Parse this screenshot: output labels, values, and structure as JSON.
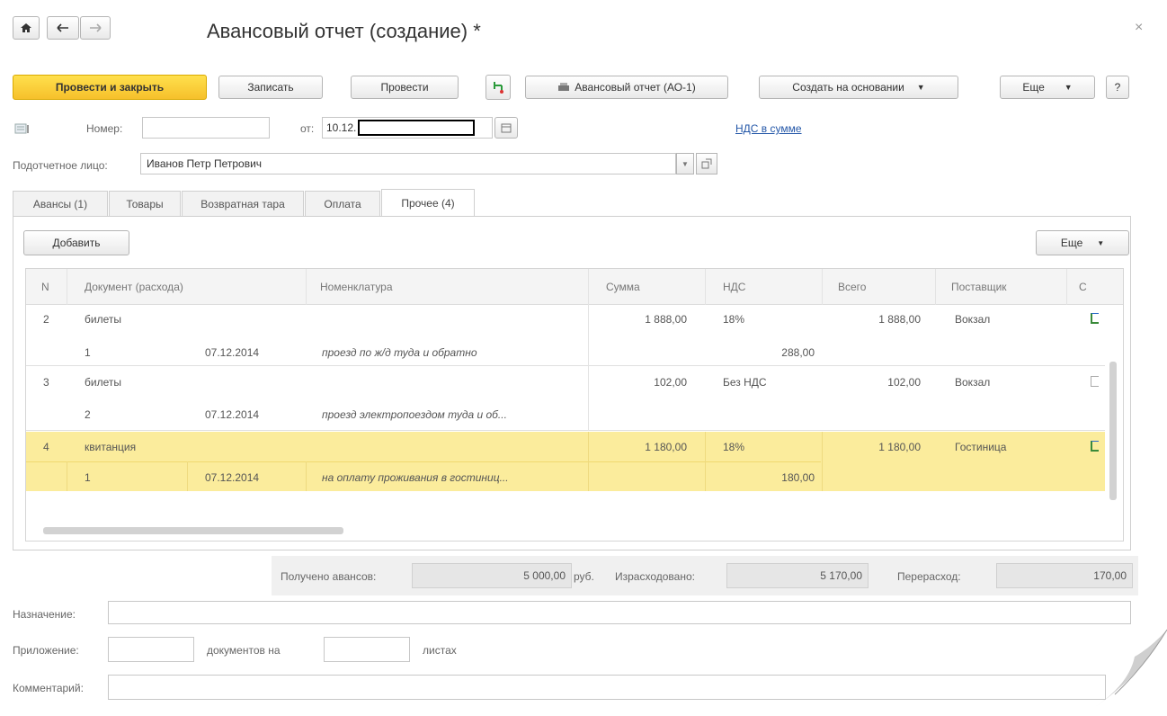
{
  "window": {
    "title": "Авансовый отчет (создание) *",
    "close_glyph": "×"
  },
  "toolbar": {
    "post_close": "Провести и закрыть",
    "save": "Записать",
    "post": "Провести",
    "print_ao1": "Авансовый отчет (АО-1)",
    "create_based": "Создать на основании",
    "more": "Еще",
    "help": "?"
  },
  "header": {
    "number_label": "Номер:",
    "number_value": "",
    "date_label": "от:",
    "date_value": "10.12.",
    "vat_link": "НДС в сумме",
    "person_label": "Подотчетное лицо:",
    "person_value": "Иванов Петр Петрович"
  },
  "tabs": [
    {
      "label": "Авансы (1)"
    },
    {
      "label": "Товары"
    },
    {
      "label": "Возвратная тара"
    },
    {
      "label": "Оплата"
    },
    {
      "label": "Прочее (4)"
    }
  ],
  "table_toolbar": {
    "add": "Добавить",
    "more": "Еще"
  },
  "table": {
    "columns": [
      "N",
      "Документ (расхода)",
      "Номенклатура",
      "Сумма",
      "НДС",
      "Всего",
      "Поставщик",
      "С"
    ],
    "rows": [
      {
        "n": "2",
        "doc": "билеты",
        "sum": "1 888,00",
        "vat": "18%",
        "total": "1 888,00",
        "supplier": "Вокзал",
        "sub_n": "1",
        "sub_date": "07.12.2014",
        "sub_desc": "проезд по ж/д туда и обратно",
        "sub_vat": "288,00"
      },
      {
        "n": "3",
        "doc": "билеты",
        "sum": "102,00",
        "vat": "Без НДС",
        "total": "102,00",
        "supplier": "Вокзал",
        "sub_n": "2",
        "sub_date": "07.12.2014",
        "sub_desc": "проезд электропоездом туда и об...",
        "sub_vat": ""
      },
      {
        "n": "4",
        "doc": "квитанция",
        "sum": "1 180,00",
        "vat": "18%",
        "total": "1 180,00",
        "supplier": "Гостиница",
        "sub_n": "1",
        "sub_date": "07.12.2014",
        "sub_desc": "на оплату проживания в гостиниц...",
        "sub_vat": "180,00"
      }
    ]
  },
  "totals": {
    "received_label": "Получено авансов:",
    "received_value": "5 000,00",
    "currency": "руб.",
    "spent_label": "Израсходовано:",
    "spent_value": "5 170,00",
    "overspend_label": "Перерасход:",
    "overspend_value": "170,00"
  },
  "footer": {
    "purpose_label": "Назначение:",
    "attach_label": "Приложение:",
    "docs_on_label": "документов на",
    "sheets_label": "листах",
    "comment_label": "Комментарий:"
  },
  "colors": {
    "primary_button": "#f6c02b",
    "selected_row": "#fbec9c",
    "link": "#2457a8"
  }
}
